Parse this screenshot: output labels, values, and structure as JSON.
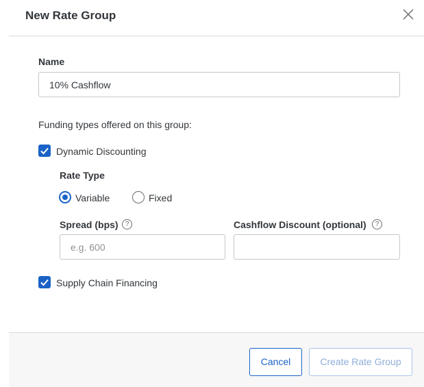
{
  "dialog": {
    "title": "New Rate Group"
  },
  "form": {
    "name_label": "Name",
    "name_value": "10% Cashflow",
    "funding_types_label": "Funding types offered on this group:",
    "dynamic_discounting": {
      "label": "Dynamic Discounting",
      "checked": true
    },
    "rate_type": {
      "label": "Rate Type",
      "options": [
        {
          "label": "Variable",
          "selected": true
        },
        {
          "label": "Fixed",
          "selected": false
        }
      ]
    },
    "spread": {
      "label": "Spread (bps)",
      "placeholder": "e.g. 600",
      "value": ""
    },
    "cashflow_discount": {
      "label": "Cashflow Discount (optional)",
      "value": ""
    },
    "supply_chain_financing": {
      "label": "Supply Chain Financing",
      "checked": true
    },
    "help_glyph": "?"
  },
  "footer": {
    "cancel_label": "Cancel",
    "create_label": "Create Rate Group"
  },
  "colors": {
    "accent": "#1a62c6",
    "disabled_text": "#8fadd8",
    "text": "#32363a"
  }
}
